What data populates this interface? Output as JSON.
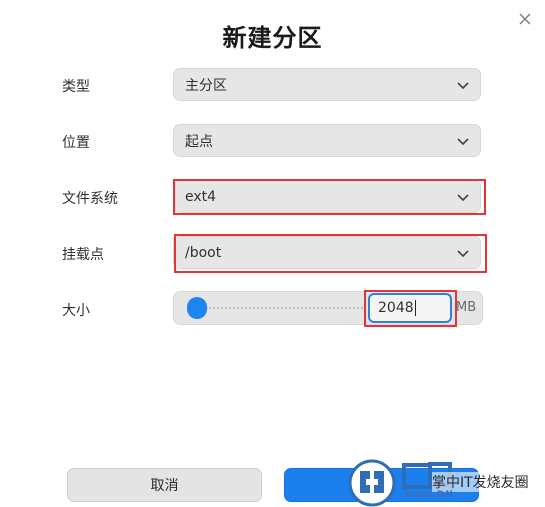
{
  "dialog": {
    "title": "新建分区",
    "close_icon": "close-icon"
  },
  "fields": {
    "type": {
      "label": "类型",
      "value": "主分区"
    },
    "position": {
      "label": "位置",
      "value": "起点"
    },
    "filesystem": {
      "label": "文件系统",
      "value": "ext4"
    },
    "mountpoint": {
      "label": "挂载点",
      "value": "/boot"
    },
    "size": {
      "label": "大小",
      "value": "2048",
      "unit": "MB",
      "slider_level": 0.05
    }
  },
  "buttons": {
    "cancel": "取消",
    "confirm": ""
  },
  "watermark": {
    "text": "掌中IT发烧友圈",
    "url": "www.DN"
  },
  "colors": {
    "accent": "#1c7fee",
    "highlight": "#e4343b",
    "field_bg": "#e6e6e6"
  }
}
